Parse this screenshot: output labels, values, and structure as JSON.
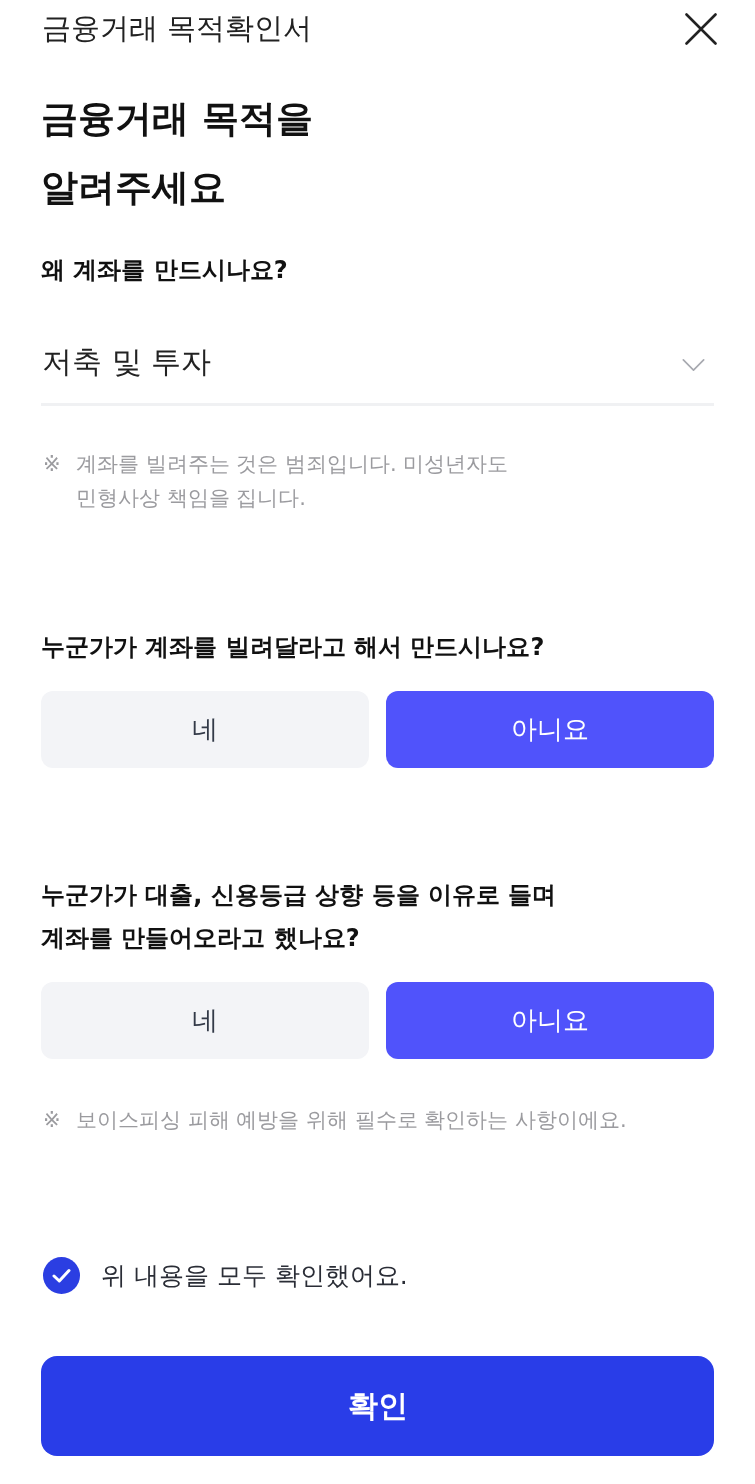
{
  "header": {
    "title": "금융거래 목적확인서"
  },
  "heading": {
    "lines": [
      "금융거래 목적을",
      "알려주세요"
    ]
  },
  "purpose": {
    "label": "왜 계좌를 만드시나요?",
    "value": "저축 및 투자"
  },
  "purpose_note": {
    "marker": "※",
    "lines": [
      "계좌를 빌려주는 것은 범죄입니다. 미성년자도",
      "민형사상 책임을 집니다."
    ]
  },
  "questions": [
    {
      "lines": [
        "누군가가 계좌를 빌려달라고 해서 만드시나요?"
      ],
      "options": [
        {
          "label": "네",
          "selected": false
        },
        {
          "label": "아니요",
          "selected": true
        }
      ]
    },
    {
      "lines": [
        "누군가가 대출, 신용등급 상향 등을 이유로 들며",
        "계좌를 만들어오라고 했나요?"
      ],
      "options": [
        {
          "label": "네",
          "selected": false
        },
        {
          "label": "아니요",
          "selected": true
        }
      ]
    }
  ],
  "phishing_note": {
    "marker": "※",
    "lines": [
      "보이스피싱 피해 예방을 위해 필수로 확인하는 사항이에요."
    ]
  },
  "agreement": {
    "label": "위 내용을 모두 확인했어요.",
    "checked": true
  },
  "confirm_button": {
    "label": "확인"
  }
}
